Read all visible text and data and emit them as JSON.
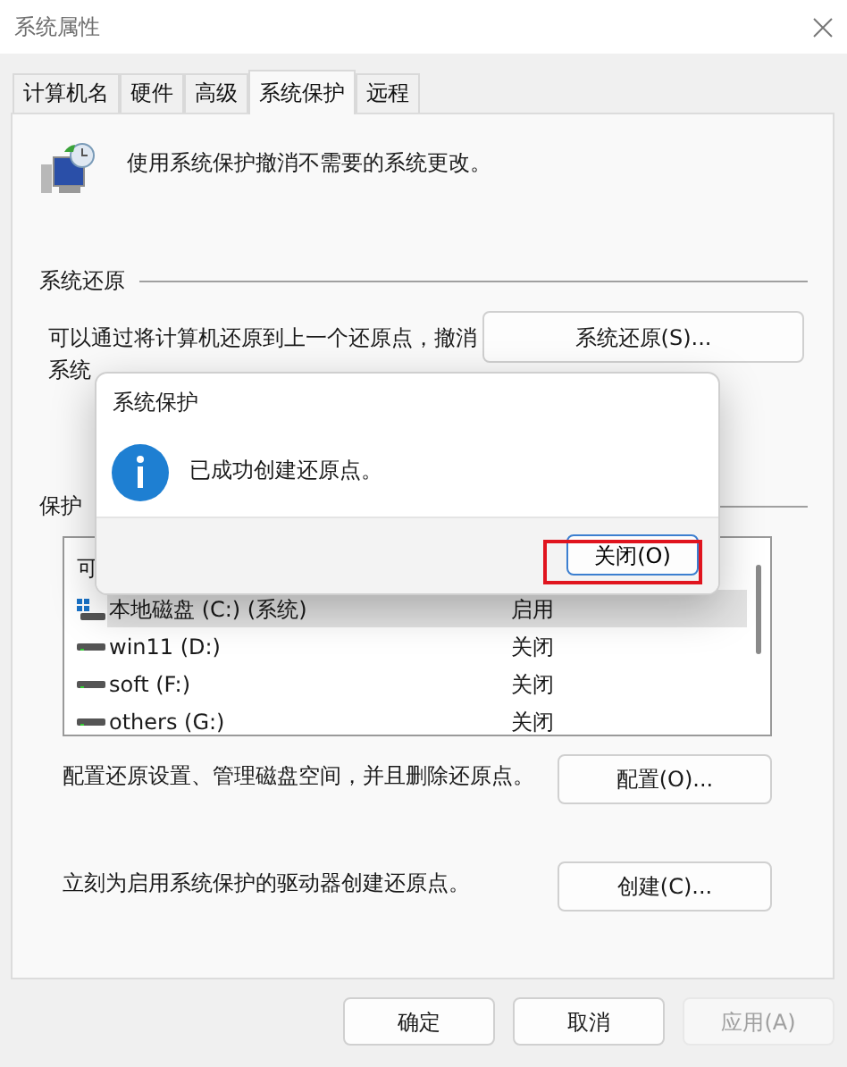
{
  "window": {
    "title": "系统属性"
  },
  "tabs": [
    {
      "label": "计算机名",
      "selected": false
    },
    {
      "label": "硬件",
      "selected": false
    },
    {
      "label": "高级",
      "selected": false
    },
    {
      "label": "系统保护",
      "selected": true
    },
    {
      "label": "远程",
      "selected": false
    }
  ],
  "description": "使用系统保护撤消不需要的系统更改。",
  "restore": {
    "heading": "系统还原",
    "text_lines": [
      "可以通过将计算机还原到上一个还原点，撤消",
      "系统"
    ],
    "button": "系统还原(S)..."
  },
  "protection": {
    "heading": "保护",
    "column_1": "可",
    "drives": [
      {
        "name": "本地磁盘 (C:) (系统)",
        "status": "启用",
        "kind": "system",
        "selected": true
      },
      {
        "name": "win11 (D:)",
        "status": "关闭",
        "kind": "drive",
        "selected": false
      },
      {
        "name": "soft (F:)",
        "status": "关闭",
        "kind": "drive",
        "selected": false
      },
      {
        "name": "others (G:)",
        "status": "关闭",
        "kind": "drive",
        "selected": false
      }
    ]
  },
  "configure": {
    "text": "配置还原设置、管理磁盘空间，并且删除还原点。",
    "button": "配置(O)..."
  },
  "create": {
    "text": "立刻为启用系统保护的驱动器创建还原点。",
    "button": "创建(C)..."
  },
  "footer_buttons": [
    {
      "label": "确定",
      "disabled": false
    },
    {
      "label": "取消",
      "disabled": false
    },
    {
      "label": "应用(A)",
      "disabled": true
    }
  ],
  "dialog": {
    "title": "系统保护",
    "message": "已成功创建还原点。",
    "button": "关闭(O)",
    "highlighted": true
  }
}
